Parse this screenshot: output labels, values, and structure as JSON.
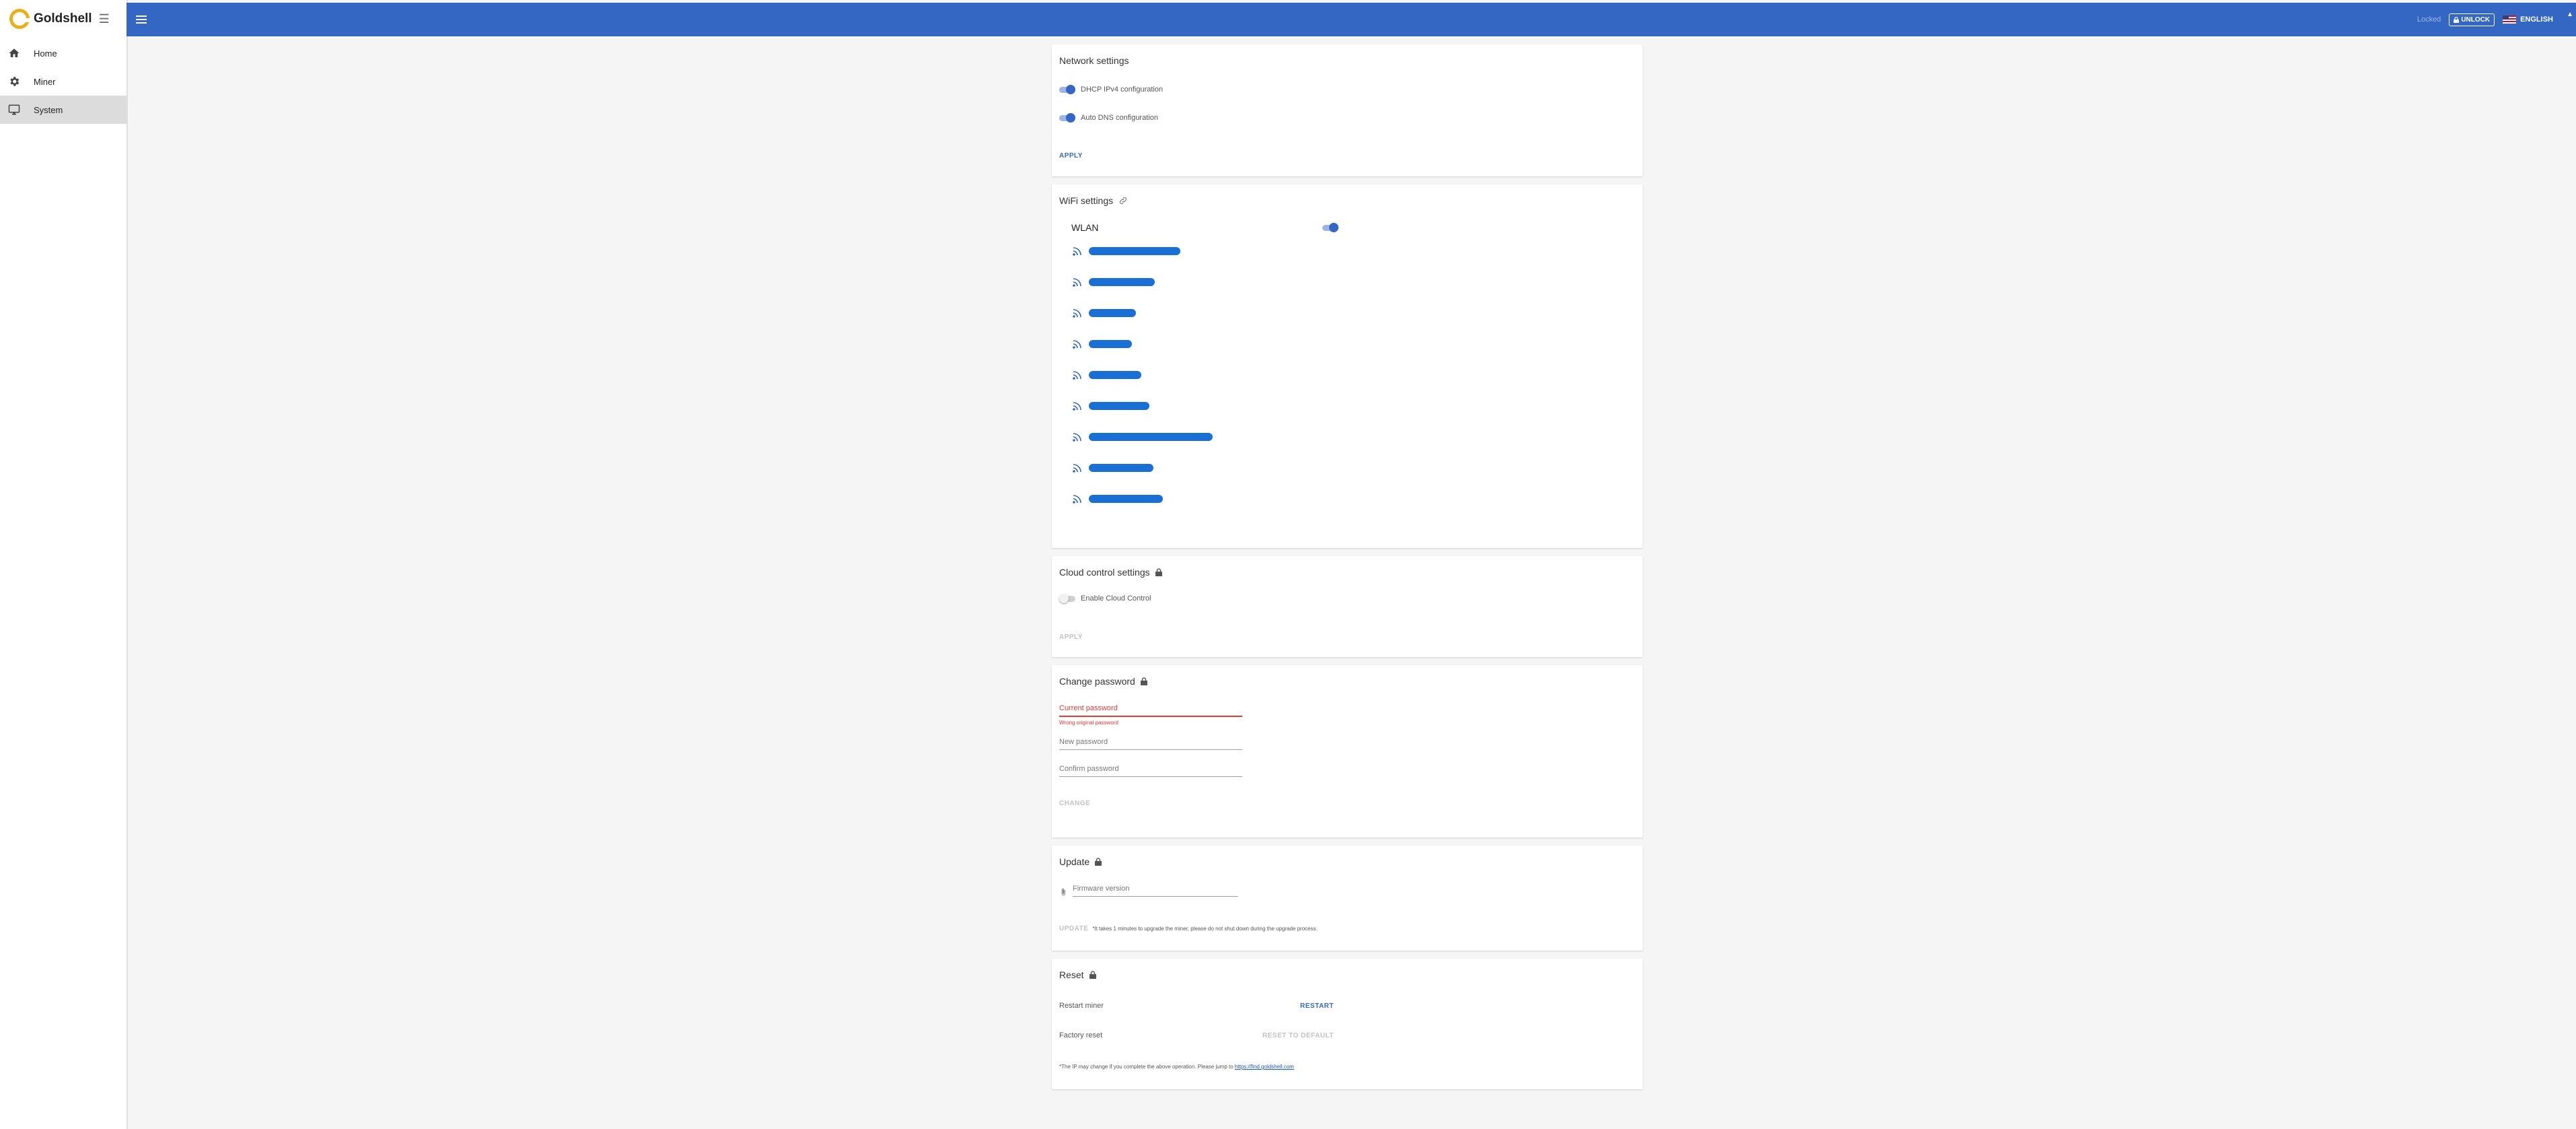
{
  "app": {
    "name": "Goldshell"
  },
  "sidebar": {
    "items": [
      {
        "label": "Home",
        "icon": "home-icon"
      },
      {
        "label": "Miner",
        "icon": "gear-icon"
      },
      {
        "label": "System",
        "icon": "monitor-icon",
        "active": true
      }
    ]
  },
  "topbar": {
    "locked": "Locked",
    "unlock": "UNLOCK",
    "language": "ENGLISH"
  },
  "network": {
    "title": "Network settings",
    "dhcp": "DHCP IPv4 configuration",
    "dns": "Auto DNS configuration",
    "apply": "APPLY"
  },
  "wifi": {
    "title": "WiFi settings",
    "wlan": "WLAN",
    "networks_visible": 9
  },
  "cloud": {
    "title": "Cloud control settings",
    "enable": "Enable Cloud Control",
    "apply": "APPLY"
  },
  "password": {
    "title": "Change password",
    "current": "Current password",
    "current_error": "Wrong original password",
    "new": "New password",
    "confirm": "Confirm password",
    "change": "CHANGE"
  },
  "update": {
    "title": "Update",
    "firmware": "Firmware version",
    "button": "UPDATE",
    "note": "*It takes 1 minutes to upgrade the miner, please do not shut down during the upgrade process."
  },
  "reset": {
    "title": "Reset",
    "restart_label": "Restart miner",
    "restart_btn": "RESTART",
    "factory_label": "Factory reset",
    "factory_btn": "RESET TO DEFAULT",
    "note": "*The IP may change if you complete the above operation. Please jump to",
    "link": "https://find.goldshell.com"
  },
  "colors": {
    "primary": "#3466c4",
    "brand": "#e8b11b",
    "error": "#e53935"
  }
}
